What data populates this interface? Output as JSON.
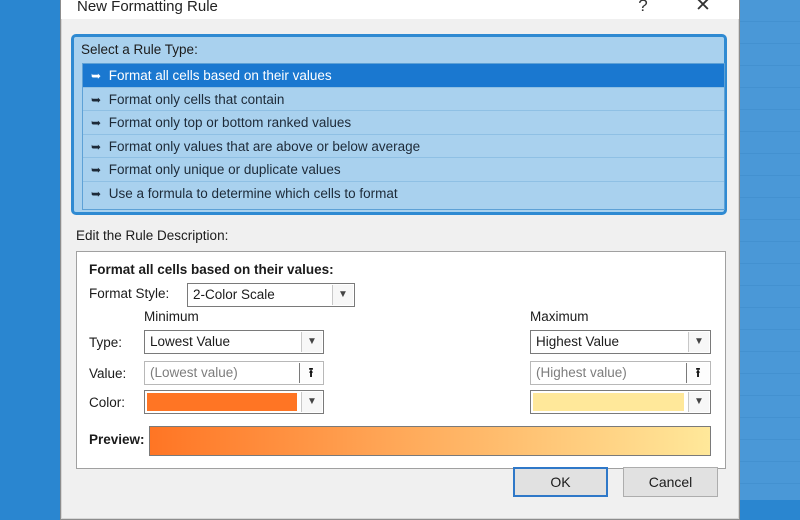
{
  "dialog": {
    "title": "New Formatting Rule",
    "help_glyph": "?",
    "close_glyph": "✕"
  },
  "rule_types": {
    "label": "Select a Rule Type:",
    "items": [
      {
        "label": "Format all cells based on their values",
        "selected": true
      },
      {
        "label": "Format only cells that contain",
        "selected": false
      },
      {
        "label": "Format only top or bottom ranked values",
        "selected": false
      },
      {
        "label": "Format only values that are above or below average",
        "selected": false
      },
      {
        "label": "Format only unique or duplicate values",
        "selected": false
      },
      {
        "label": "Use a formula to determine which cells to format",
        "selected": false
      }
    ],
    "arrow_glyph": "➥"
  },
  "description": {
    "label": "Edit the Rule Description:",
    "heading": "Format all cells based on their values:",
    "format_style_label": "Format Style:",
    "format_style_value": "2-Color Scale",
    "type_label": "Type:",
    "value_label": "Value:",
    "color_label": "Color:",
    "preview_label": "Preview:",
    "minimum": {
      "header": "Minimum",
      "type": "Lowest Value",
      "value_placeholder": "(Lowest value)",
      "color": "#ff7524"
    },
    "maximum": {
      "header": "Maximum",
      "type": "Highest Value",
      "value_placeholder": "(Highest value)",
      "color": "#ffe89a"
    }
  },
  "buttons": {
    "ok": "OK",
    "cancel": "Cancel"
  },
  "icons": {
    "dropdown": "chevron-down-icon",
    "range_picker": "collapse-dialog-icon"
  }
}
